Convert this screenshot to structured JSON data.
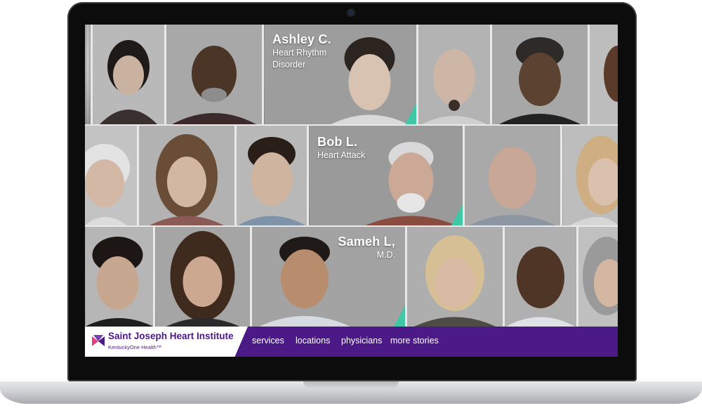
{
  "brand": {
    "title": "Saint Joseph Heart Institute",
    "subtitle": "KentuckyOne Health™",
    "accent_color": "#4b1a87",
    "highlight_color": "#3fc7a6"
  },
  "nav": {
    "items": [
      {
        "label": "services"
      },
      {
        "label": "locations"
      },
      {
        "label": "physicians"
      },
      {
        "label": "more stories"
      }
    ]
  },
  "stories": [
    {
      "name": "Ashley C.",
      "desc_line1": "Heart Rhythm",
      "desc_line2": "Disorder"
    },
    {
      "name": "Bob L.",
      "desc_line1": "Heart Attack"
    },
    {
      "name": "Sameh L,",
      "desc_line1": "M.D."
    }
  ]
}
